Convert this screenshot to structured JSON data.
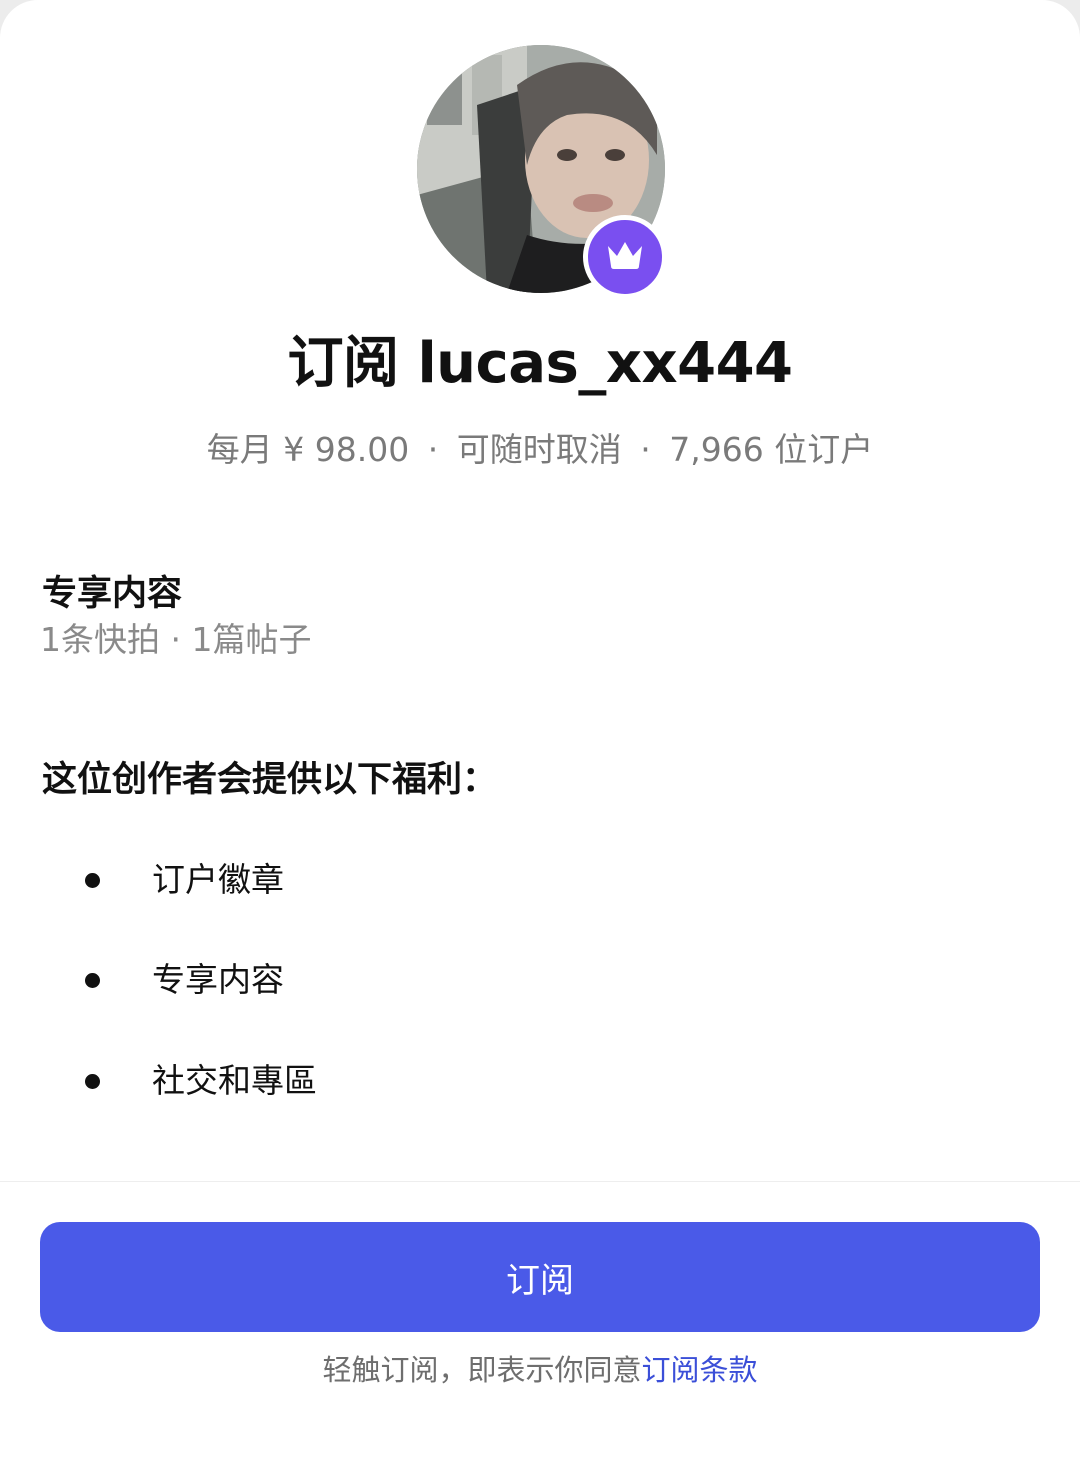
{
  "header": {
    "title": "订阅 lucas_xx444",
    "price": "每月 ¥  98.00",
    "cancel_note": "可随时取消",
    "subscribers": "7,966 位订户",
    "separator": "·",
    "badge_icon": "crown-icon"
  },
  "exclusive": {
    "title": "专享内容",
    "summary": "1条快拍 · 1篇帖子"
  },
  "benefits": {
    "title": "这位创作者会提供以下福利：",
    "items": [
      {
        "label": "订户徽章"
      },
      {
        "label": "专享内容"
      },
      {
        "label": "社交和專區"
      }
    ]
  },
  "footer": {
    "subscribe_label": "订阅",
    "terms_prefix": "轻触订阅，即表示你同意",
    "terms_link": "订阅条款"
  },
  "colors": {
    "accent": "#4a5ae8",
    "badge": "#7a4ff0",
    "link": "#3b4fd8"
  }
}
